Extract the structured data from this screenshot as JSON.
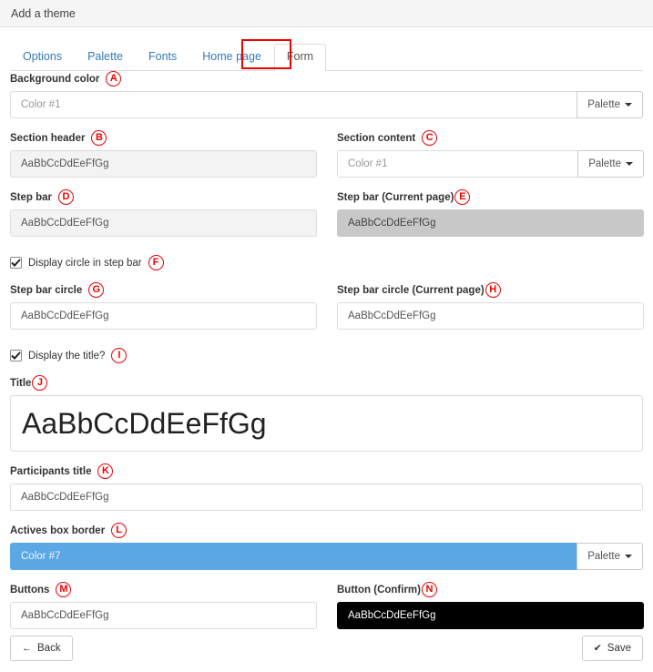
{
  "window": {
    "title": "Add a theme"
  },
  "tabs": [
    {
      "label": "Options",
      "active": false
    },
    {
      "label": "Palette",
      "active": false
    },
    {
      "label": "Fonts",
      "active": false
    },
    {
      "label": "Home page",
      "active": false
    },
    {
      "label": "Form",
      "active": true
    }
  ],
  "annotations": {
    "a": "A",
    "b": "B",
    "c": "C",
    "d": "D",
    "e": "E",
    "f": "F",
    "g": "G",
    "h": "H",
    "i": "I",
    "j": "J",
    "k": "K",
    "l": "L",
    "m": "M",
    "n": "N"
  },
  "colors": {
    "annotation": "#ee0000",
    "tab_active_text": "#555555",
    "tab_link": "#337ab7",
    "sample_gray_light": "#f3f3f3",
    "sample_gray_dark": "#c8c8c8",
    "sample_blue": "#5ba8e5",
    "sample_black": "#000000"
  },
  "palette_button": {
    "label": "Palette",
    "caret": "caret-down-icon"
  },
  "fields": {
    "background_color": {
      "label": "Background color",
      "value": "",
      "placeholder": "Color #1"
    },
    "section_header": {
      "label": "Section header",
      "value": "AaBbCcDdEeFfGg"
    },
    "section_content": {
      "label": "Section content",
      "value": "",
      "placeholder": "Color #1"
    },
    "step_bar": {
      "label": "Step bar",
      "value": "AaBbCcDdEeFfGg"
    },
    "step_bar_current": {
      "label": "Step bar (Current page)",
      "value": "AaBbCcDdEeFfGg"
    },
    "display_circle_in_step_bar": {
      "label": "Display circle in step bar",
      "checked": true
    },
    "step_bar_circle": {
      "label": "Step bar circle",
      "value": "AaBbCcDdEeFfGg"
    },
    "step_bar_circle_current": {
      "label": "Step bar circle (Current page)",
      "value": "AaBbCcDdEeFfGg"
    },
    "display_the_title": {
      "label": "Display the title?",
      "checked": true
    },
    "title": {
      "label": "Title",
      "value": "AaBbCcDdEeFfGg"
    },
    "participants_title": {
      "label": "Participants title",
      "value": "AaBbCcDdEeFfGg"
    },
    "actives_box_border": {
      "label": "Actives box border",
      "value": "",
      "placeholder": "Color #7"
    },
    "buttons": {
      "label": "Buttons",
      "value": "AaBbCcDdEeFfGg"
    },
    "button_confirm": {
      "label": "Button (Confirm)",
      "value": "AaBbCcDdEeFfGg"
    }
  },
  "footer": {
    "back": {
      "label": "Back",
      "icon": "arrow-left-icon"
    },
    "save": {
      "label": "Save",
      "icon": "check-icon"
    }
  }
}
